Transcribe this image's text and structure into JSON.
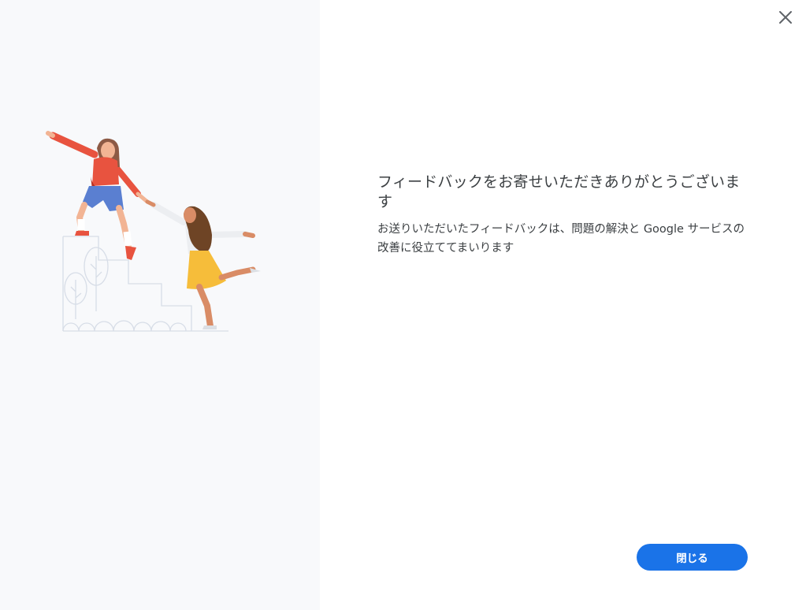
{
  "dialog": {
    "title": "フィードバックをお寄せいただきありがとうございます",
    "message": "お送りいただいたフィードバックは、問題の解決と Google サービスの改善に役立ててまいります",
    "close_button_label": "閉じる"
  },
  "icons": {
    "close": "close-icon",
    "illustration": "people-climbing-stairs-illustration"
  },
  "colors": {
    "accent": "#1a73e8",
    "text": "#3c4043",
    "left_panel_bg": "#f8f9fb"
  }
}
